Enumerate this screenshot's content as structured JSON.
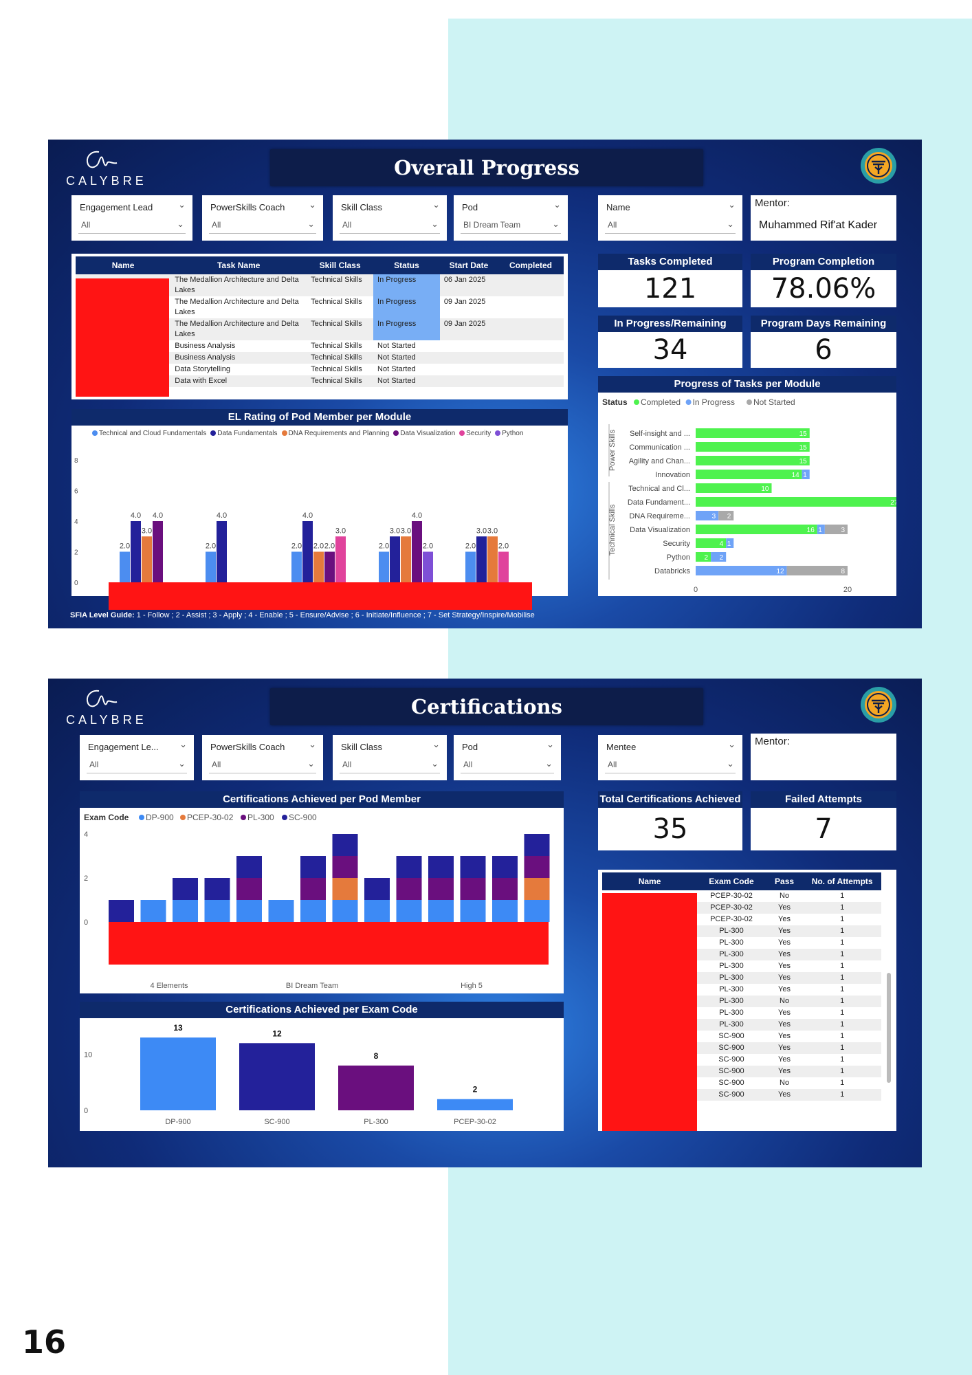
{
  "page_number": "16",
  "dash1": {
    "brand": "CALYBRE",
    "title": "Overall Progress",
    "slicers": [
      {
        "label": "Engagement Lead",
        "value": "All"
      },
      {
        "label": "PowerSkills Coach",
        "value": "All"
      },
      {
        "label": "Skill Class",
        "value": "All"
      },
      {
        "label": "Pod",
        "value": "BI Dream Team"
      },
      {
        "label": "Name",
        "value": "All"
      }
    ],
    "mentor": {
      "label": "Mentor:",
      "value": "Muhammed Rif'at Kader"
    },
    "kpis": [
      {
        "label": "Tasks Completed",
        "value": "121"
      },
      {
        "label": "Program Completion",
        "value": "78.06%"
      },
      {
        "label": "In Progress/Remaining",
        "value": "34"
      },
      {
        "label": "Program Days Remaining",
        "value": "6"
      }
    ],
    "task_table": {
      "headers": [
        "Name",
        "Task Name",
        "Skill Class",
        "Status",
        "Start Date",
        "Completed"
      ],
      "rows": [
        [
          "",
          "The Medallion Architecture and Delta Lakes",
          "Technical Skills",
          "In Progress",
          "06 Jan 2025",
          ""
        ],
        [
          "",
          "The Medallion Architecture and Delta Lakes",
          "Technical Skills",
          "In Progress",
          "09 Jan 2025",
          ""
        ],
        [
          "",
          "The Medallion Architecture and Delta Lakes",
          "Technical Skills",
          "In Progress",
          "09 Jan 2025",
          ""
        ],
        [
          "",
          "Business Analysis",
          "Technical Skills",
          "Not Started",
          "",
          ""
        ],
        [
          "",
          "Business Analysis",
          "Technical Skills",
          "Not Started",
          "",
          ""
        ],
        [
          "",
          "Data Storytelling",
          "Technical Skills",
          "Not Started",
          "",
          ""
        ],
        [
          "",
          "Data with Excel",
          "Technical Skills",
          "Not Started",
          "",
          ""
        ]
      ]
    },
    "el_chart_title": "EL Rating of Pod Member per Module",
    "progress_chart_title": "Progress of Tasks per Module",
    "footer": {
      "label": "SFIA Level Guide:",
      "text": " 1 - Follow ; 2 - Assist ; 3 - Apply ; 4 - Enable ; 5 - Ensure/Advise ; 6 - Initiate/Influence ; 7 - Set Strategy/Inspire/Mobilise"
    }
  },
  "dash2": {
    "brand": "CALYBRE",
    "title": "Certifications",
    "slicers": [
      {
        "label": "Engagement Le...",
        "value": "All"
      },
      {
        "label": "PowerSkills Coach",
        "value": "All"
      },
      {
        "label": "Skill Class",
        "value": "All"
      },
      {
        "label": "Pod",
        "value": "All"
      },
      {
        "label": "Mentee",
        "value": "All"
      }
    ],
    "mentor": {
      "label": "Mentor:",
      "value": ""
    },
    "kpis": [
      {
        "label": "Total Certifications Achieved",
        "value": "35"
      },
      {
        "label": "Failed Attempts",
        "value": "7"
      }
    ],
    "cert_pod_title": "Certifications Achieved per Pod Member",
    "cert_exam_title": "Certifications Achieved per Exam Code",
    "cert_table": {
      "headers": [
        "Name",
        "Exam Code",
        "Pass",
        "No. of Attempts"
      ],
      "rows": [
        [
          "PCEP-30-02",
          "No",
          "1"
        ],
        [
          "PCEP-30-02",
          "Yes",
          "1"
        ],
        [
          "PCEP-30-02",
          "Yes",
          "1"
        ],
        [
          "PL-300",
          "Yes",
          "1"
        ],
        [
          "PL-300",
          "Yes",
          "1"
        ],
        [
          "PL-300",
          "Yes",
          "1"
        ],
        [
          "PL-300",
          "Yes",
          "1"
        ],
        [
          "PL-300",
          "Yes",
          "1"
        ],
        [
          "PL-300",
          "Yes",
          "1"
        ],
        [
          "PL-300",
          "No",
          "1"
        ],
        [
          "PL-300",
          "Yes",
          "1"
        ],
        [
          "PL-300",
          "Yes",
          "1"
        ],
        [
          "SC-900",
          "Yes",
          "1"
        ],
        [
          "SC-900",
          "Yes",
          "1"
        ],
        [
          "SC-900",
          "Yes",
          "1"
        ],
        [
          "SC-900",
          "Yes",
          "1"
        ],
        [
          "SC-900",
          "No",
          "1"
        ],
        [
          "SC-900",
          "Yes",
          "1"
        ]
      ]
    }
  },
  "chart_data": [
    {
      "type": "bar",
      "id": "el_rating",
      "title": "EL Rating of Pod Member per Module",
      "ylim": [
        0,
        8
      ],
      "yticks": [
        0,
        2,
        4,
        6,
        8
      ],
      "series": [
        {
          "name": "Technical and Cloud Fundamentals",
          "color": "#4c8df0"
        },
        {
          "name": "Data Fundamentals",
          "color": "#23219a"
        },
        {
          "name": "DNA Requirements and Planning",
          "color": "#e57a3c"
        },
        {
          "name": "Data Visualization",
          "color": "#6a0f7e"
        },
        {
          "name": "Security",
          "color": "#e0439c"
        },
        {
          "name": "Python",
          "color": "#7e4fd6"
        }
      ],
      "groups": [
        {
          "bars": [
            {
              "s": 0,
              "v": 2.0
            },
            {
              "s": 1,
              "v": 4.0
            },
            {
              "s": 2,
              "v": 3.0
            },
            {
              "s": 3,
              "v": 4.0
            }
          ],
          "labels": [
            "2.0",
            "4.0",
            "3.0",
            "4.0"
          ]
        },
        {
          "bars": [
            {
              "s": 0,
              "v": 2.0
            },
            {
              "s": 1,
              "v": 4.0
            }
          ],
          "labels": [
            "2.0",
            "4.0"
          ]
        },
        {
          "bars": [
            {
              "s": 0,
              "v": 2.0
            },
            {
              "s": 1,
              "v": 4.0
            },
            {
              "s": 2,
              "v": 2.0
            },
            {
              "s": 3,
              "v": 2.0
            },
            {
              "s": 4,
              "v": 3.0
            }
          ],
          "labels": [
            "2.0",
            "4.0",
            "2.0",
            "2.0",
            "3.0"
          ]
        },
        {
          "bars": [
            {
              "s": 0,
              "v": 2.0
            },
            {
              "s": 1,
              "v": 3.0
            },
            {
              "s": 2,
              "v": 3.0
            },
            {
              "s": 3,
              "v": 4.0
            },
            {
              "s": 5,
              "v": 2.0
            }
          ],
          "labels": [
            "2.0",
            "3.0",
            "3.0",
            "4.0",
            "2.0"
          ]
        },
        {
          "bars": [
            {
              "s": 0,
              "v": 2.0
            },
            {
              "s": 1,
              "v": 3.0
            },
            {
              "s": 2,
              "v": 3.0
            },
            {
              "s": 4,
              "v": 2.0
            }
          ],
          "labels": [
            "2.0",
            "3.0",
            "3.0",
            "2.0"
          ]
        }
      ]
    },
    {
      "type": "bar",
      "id": "progress_per_module",
      "title": "Progress of Tasks per Module",
      "legend_title": "Status",
      "series": [
        {
          "name": "Completed",
          "color": "#4ef24e"
        },
        {
          "name": "In Progress",
          "color": "#6fa3f7"
        },
        {
          "name": "Not Started",
          "color": "#a9a9a9"
        }
      ],
      "group_labels": [
        "Power Skills",
        "Technical Skills"
      ],
      "xlim": [
        0,
        30
      ],
      "xticks": [
        0,
        20
      ],
      "categories": [
        {
          "label": "Self-insight and ...",
          "group": 0,
          "completed": 15,
          "in_progress": 0,
          "not_started": 0
        },
        {
          "label": "Communication ...",
          "group": 0,
          "completed": 15,
          "in_progress": 0,
          "not_started": 0
        },
        {
          "label": "Agility and Chan...",
          "group": 0,
          "completed": 15,
          "in_progress": 0,
          "not_started": 0
        },
        {
          "label": "Innovation",
          "group": 0,
          "completed": 14,
          "in_progress": 1,
          "not_started": 0
        },
        {
          "label": "Technical and Cl...",
          "group": 1,
          "completed": 10,
          "in_progress": 0,
          "not_started": 0
        },
        {
          "label": "Data Fundament...",
          "group": 1,
          "completed": 27,
          "in_progress": 2,
          "not_started": 0
        },
        {
          "label": "DNA Requireme...",
          "group": 1,
          "completed": 0,
          "in_progress": 3,
          "not_started": 2
        },
        {
          "label": "Data Visualization",
          "group": 1,
          "completed": 16,
          "in_progress": 1,
          "not_started": 3
        },
        {
          "label": "Security",
          "group": 1,
          "completed": 4,
          "in_progress": 1,
          "not_started": 0
        },
        {
          "label": "Python",
          "group": 1,
          "completed": 2,
          "in_progress": 2,
          "not_started": 0
        },
        {
          "label": "Databricks",
          "group": 1,
          "completed": 0,
          "in_progress": 12,
          "not_started": 8
        }
      ]
    },
    {
      "type": "bar",
      "id": "cert_per_member",
      "title": "Certifications Achieved per Pod Member",
      "legend_title": "Exam Code",
      "series": [
        {
          "name": "DP-900",
          "color": "#3d8af5"
        },
        {
          "name": "PCEP-30-02",
          "color": "#e57a3c"
        },
        {
          "name": "PL-300",
          "color": "#6a0f7e"
        },
        {
          "name": "SC-900",
          "color": "#23219a"
        }
      ],
      "ylim": [
        0,
        4
      ],
      "yticks": [
        0,
        2,
        4
      ],
      "x_groups": [
        "4 Elements",
        "BI Dream Team",
        "High 5"
      ],
      "stacks": [
        {
          "SC-900": 1
        },
        {
          "DP-900": 1
        },
        {
          "DP-900": 1,
          "SC-900": 1
        },
        {
          "DP-900": 1,
          "SC-900": 1
        },
        {
          "DP-900": 1,
          "PL-300": 1,
          "SC-900": 1
        },
        {
          "DP-900": 1
        },
        {
          "DP-900": 1,
          "PL-300": 1,
          "SC-900": 1
        },
        {
          "DP-900": 1,
          "PCEP-30-02": 1,
          "PL-300": 1,
          "SC-900": 1
        },
        {
          "DP-900": 1,
          "SC-900": 1
        },
        {
          "DP-900": 1,
          "PL-300": 1,
          "SC-900": 1
        },
        {
          "DP-900": 1,
          "PL-300": 1,
          "SC-900": 1
        },
        {
          "DP-900": 1,
          "PL-300": 1,
          "SC-900": 1
        },
        {
          "DP-900": 1,
          "PL-300": 1,
          "SC-900": 1
        },
        {
          "DP-900": 1,
          "PCEP-30-02": 1,
          "PL-300": 1,
          "SC-900": 1
        }
      ]
    },
    {
      "type": "bar",
      "id": "cert_per_exam",
      "title": "Certifications Achieved per Exam Code",
      "categories": [
        "DP-900",
        "SC-900",
        "PL-300",
        "PCEP-30-02"
      ],
      "values": [
        13,
        12,
        8,
        2
      ],
      "colors": [
        "#3d8af5",
        "#23219a",
        "#6a0f7e",
        "#3d8af5"
      ],
      "ylim": [
        0,
        14
      ],
      "yticks": [
        0,
        10
      ]
    }
  ]
}
